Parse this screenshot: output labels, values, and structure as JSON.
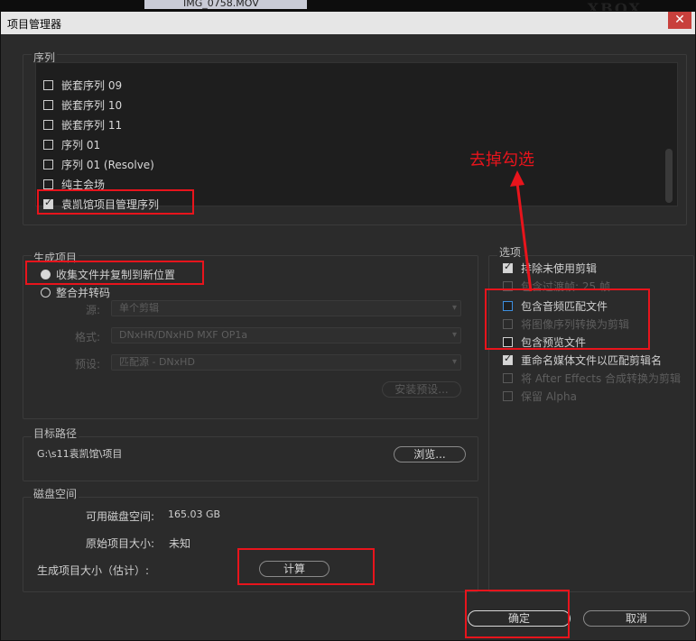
{
  "background": {
    "thumb_label": "IMG_0758.MOV",
    "logo_text": "XBOX"
  },
  "window": {
    "title": "项目管理器",
    "close_glyph": "✕"
  },
  "sequence": {
    "section_label": "序列",
    "items": [
      {
        "label": "嵌套序列 09",
        "checked": false
      },
      {
        "label": "嵌套序列 10",
        "checked": false
      },
      {
        "label": "嵌套序列 11",
        "checked": false
      },
      {
        "label": "序列 01",
        "checked": false
      },
      {
        "label": "序列 01 (Resolve)",
        "checked": false
      },
      {
        "label": "纯主会场",
        "checked": false
      },
      {
        "label": "袁凯馆项目管理序列",
        "checked": true
      }
    ]
  },
  "generate": {
    "section_label": "生成项目",
    "option_collect": "收集文件并复制到新位置",
    "option_consolidate": "整合并转码",
    "source_label": "源:",
    "source_value": "单个剪辑",
    "format_label": "格式:",
    "format_value": "DNxHR/DNxHD MXF OP1a",
    "preset_label": "预设:",
    "preset_value": "匹配源 - DNxHD",
    "install_preset_label": "安装预设..."
  },
  "target": {
    "section_label": "目标路径",
    "path": "G:\\s11袁凯馆\\项目",
    "browse_label": "浏览..."
  },
  "disk": {
    "section_label": "磁盘空间",
    "available_label": "可用磁盘空间:",
    "available_value": "165.03 GB",
    "original_label": "原始项目大小:",
    "original_value": "未知",
    "result_label": "生成项目大小（估计）:",
    "calc_label": "计算"
  },
  "options": {
    "section_label": "选项",
    "items": [
      {
        "label": "排除未使用剪辑",
        "checked": true,
        "enabled": true
      },
      {
        "label": "包含过渡帧: 25 帧",
        "checked": false,
        "enabled": false
      },
      {
        "label": "包含音频匹配文件",
        "checked": false,
        "enabled": true
      },
      {
        "label": "将图像序列转换为剪辑",
        "checked": false,
        "enabled": false
      },
      {
        "label": "包含预览文件",
        "checked": false,
        "enabled": true
      },
      {
        "label": "重命名媒体文件以匹配剪辑名",
        "checked": true,
        "enabled": true
      },
      {
        "label": "将 After Effects 合成转换为剪辑",
        "checked": false,
        "enabled": false
      },
      {
        "label": "保留 Alpha",
        "checked": false,
        "enabled": false
      }
    ]
  },
  "annotation": {
    "text": "去掉勾选",
    "color": "#e8141c"
  },
  "footer": {
    "ok_label": "确定",
    "cancel_label": "取消"
  }
}
